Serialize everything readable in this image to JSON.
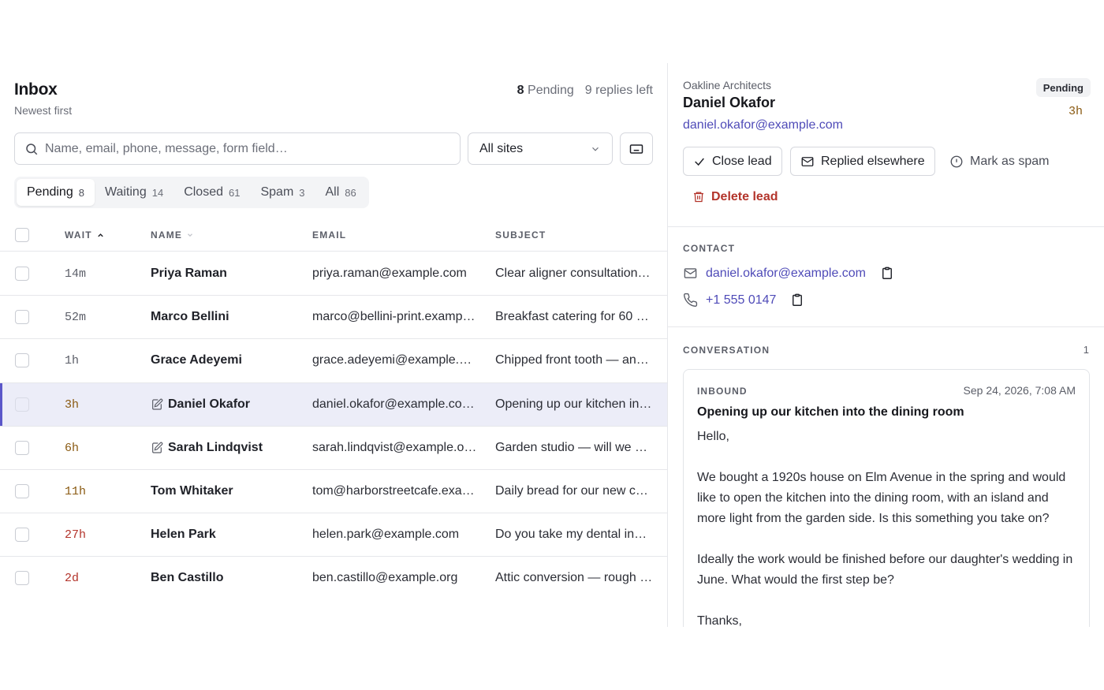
{
  "inbox": {
    "title": "Inbox",
    "subtitle": "Newest first",
    "pending_count": "8",
    "pending_label": "Pending",
    "replies_left": "9 replies left"
  },
  "search": {
    "placeholder": "Name, email, phone, message, form field…"
  },
  "site_filter": {
    "value": "All sites"
  },
  "tabs": [
    {
      "label": "Pending",
      "count": "8"
    },
    {
      "label": "Waiting",
      "count": "14"
    },
    {
      "label": "Closed",
      "count": "61"
    },
    {
      "label": "Spam",
      "count": "3"
    },
    {
      "label": "All",
      "count": "86"
    }
  ],
  "table": {
    "headers": {
      "wait": "WAIT",
      "name": "NAME",
      "email": "EMAIL",
      "subject": "SUBJECT"
    },
    "rows": [
      {
        "wait": "14m",
        "name": "Priya Raman",
        "email": "priya.raman@example.com",
        "subject": "Clear aligner consultation …"
      },
      {
        "wait": "52m",
        "name": "Marco Bellini",
        "email": "marco@bellini-print.examp…",
        "subject": "Breakfast catering for 60 …"
      },
      {
        "wait": "1h",
        "name": "Grace Adeyemi",
        "email": "grace.adeyemi@example.o…",
        "subject": "Chipped front tooth — any…"
      },
      {
        "wait": "3h",
        "name": "Daniel Okafor",
        "email": "daniel.okafor@example.co…",
        "subject": "Opening up our kitchen int…"
      },
      {
        "wait": "6h",
        "name": "Sarah Lindqvist",
        "email": "sarah.lindqvist@example.o…",
        "subject": "Garden studio — will we n…"
      },
      {
        "wait": "11h",
        "name": "Tom Whitaker",
        "email": "tom@harborstreetcafe.exa…",
        "subject": "Daily bread for our new ca…"
      },
      {
        "wait": "27h",
        "name": "Helen Park",
        "email": "helen.park@example.com",
        "subject": "Do you take my dental ins…"
      },
      {
        "wait": "2d",
        "name": "Ben Castillo",
        "email": "ben.castillo@example.org",
        "subject": "Attic conversion — rough …"
      }
    ]
  },
  "detail": {
    "company": "Oakline Architects",
    "name": "Daniel Okafor",
    "email": "daniel.okafor@example.com",
    "status": "Pending",
    "age": "3h",
    "actions": {
      "close": "Close lead",
      "replied": "Replied elsewhere",
      "spam": "Mark as spam",
      "delete": "Delete lead"
    },
    "contact": {
      "label": "CONTACT",
      "email": "daniel.okafor@example.com",
      "phone": "+1 555 0147"
    },
    "conversation": {
      "label": "CONVERSATION",
      "count": "1",
      "message": {
        "direction": "INBOUND",
        "date": "Sep 24, 2026, 7:08 AM",
        "subject": "Opening up our kitchen into the dining room",
        "body": "Hello,\n\nWe bought a 1920s house on Elm Avenue in the spring and would like to open the kitchen into the dining room, with an island and more light from the garden side. Is this something you take on?\n\nIdeally the work would be finished before our daughter's wedding in June. What would the first step be?\n\nThanks,"
      }
    }
  },
  "colors": {
    "accent": "#4f4bb8",
    "selected_row": "#ecedf8",
    "danger": "#b3342b",
    "amber": "#8a5a12"
  }
}
